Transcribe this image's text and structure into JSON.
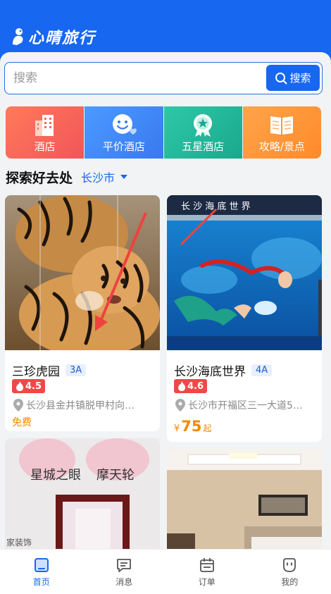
{
  "app": {
    "title": "心晴旅行"
  },
  "search": {
    "placeholder": "搜索",
    "button_label": "搜索"
  },
  "categories": [
    {
      "label": "酒店",
      "icon": "building-icon"
    },
    {
      "label": "平价酒店",
      "icon": "smile-icon"
    },
    {
      "label": "五星酒店",
      "icon": "star-badge-icon"
    },
    {
      "label": "攻略/景点",
      "icon": "book-icon"
    }
  ],
  "explore": {
    "title": "探索好去处",
    "city": "长沙市"
  },
  "cards": [
    {
      "name": "三珍虎园",
      "grade": "3A",
      "rating": "4.5",
      "address": "长沙县金井镇脱甲村向…",
      "price_text": "免费"
    },
    {
      "name": "长沙海底世界",
      "grade": "4A",
      "rating": "4.6",
      "address": "长沙市开福区三一大道5…",
      "price_currency": "¥",
      "price_value": "75",
      "price_suffix": "起"
    },
    {
      "photo_text_1": "星城之眼",
      "photo_text_2": "摩天轮",
      "photo_text_3": "家装饰"
    },
    {}
  ],
  "photo_text": {
    "aquarium_banner": "长 沙 海 底 世 界"
  },
  "tabbar": [
    {
      "label": "首页",
      "active": true
    },
    {
      "label": "消息",
      "active": false
    },
    {
      "label": "订单",
      "active": false
    },
    {
      "label": "我的",
      "active": false
    }
  ],
  "colors": {
    "brand": "#1767f0",
    "rating": "#f04848",
    "price": "#f08a00"
  }
}
